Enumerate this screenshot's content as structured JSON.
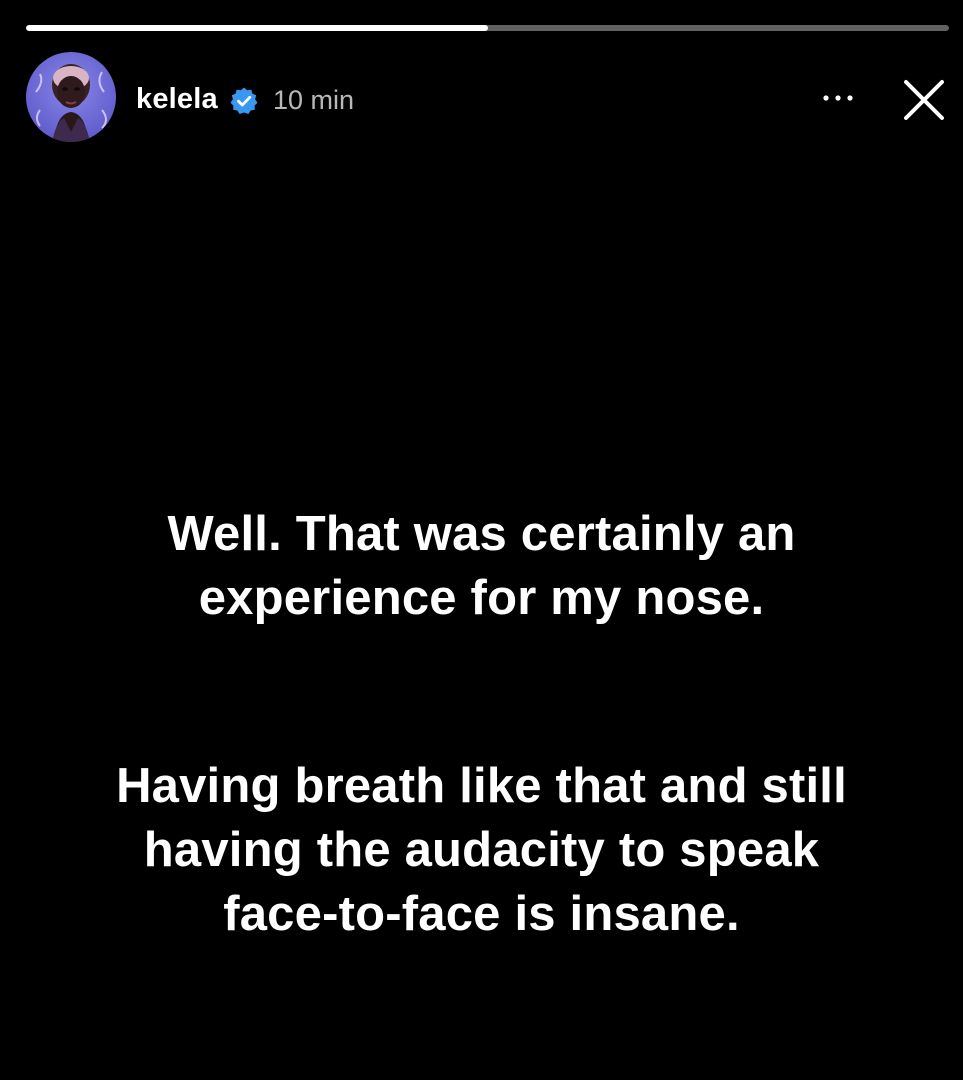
{
  "story": {
    "progress": 0.5,
    "user": {
      "username": "kelela",
      "verified_icon": "verified-badge-icon",
      "time_ago": "10 min"
    },
    "actions": {
      "more_icon": "more-icon",
      "close_icon": "close-icon"
    },
    "text_blocks": [
      {
        "lines": [
          "Well. That was certainly an",
          "experience for my nose."
        ]
      },
      {
        "lines": [
          "Having breath like that and still",
          "having the audacity to speak",
          "face-to-face is insane."
        ]
      }
    ]
  },
  "colors": {
    "background": "#000000",
    "text": "#ffffff",
    "verified": "#3897f0",
    "avatar_bg": "#6f6ad6"
  }
}
